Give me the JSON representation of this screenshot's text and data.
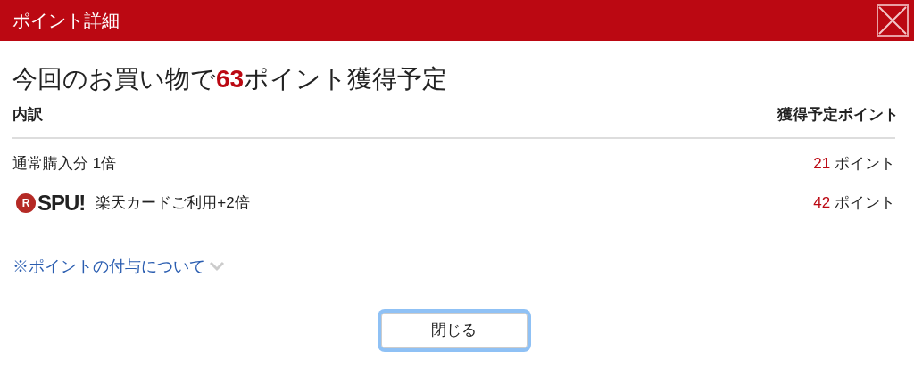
{
  "dialog": {
    "title": "ポイント詳細"
  },
  "headline": {
    "before": "今回のお買い物で",
    "points": "63",
    "after": "ポイント獲得予定"
  },
  "table": {
    "columns": [
      "内訳",
      "獲得予定ポイント"
    ],
    "rows": [
      {
        "kind": "plain",
        "label": "通常購入分 1倍",
        "points": "21",
        "unit": "ポイント"
      },
      {
        "kind": "spu",
        "logo_mark": "R",
        "logo_text": "SPU!",
        "label": "楽天カードご利用+2倍",
        "points": "42",
        "unit": "ポイント"
      }
    ]
  },
  "link": {
    "label": "※ポイントの付与について",
    "expanded": false
  },
  "button": {
    "label": "閉じる",
    "focused": true
  }
}
